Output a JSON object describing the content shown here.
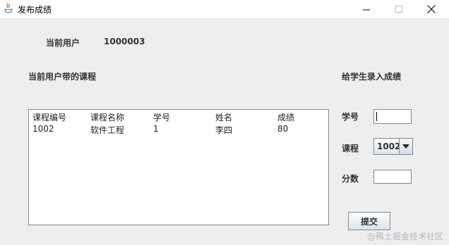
{
  "window": {
    "title": "发布成绩",
    "controls": {
      "minimize": "—",
      "maximize": "☐",
      "close": "✕"
    }
  },
  "header": {
    "current_user_label": "当前用户",
    "current_user_value": "1000003"
  },
  "courses_section": {
    "title": "当前用户带的课程",
    "columns": [
      "课程编号",
      "课程名称",
      "学号",
      "姓名",
      "成绩"
    ],
    "rows": [
      [
        "1002",
        "软件工程",
        "1",
        "李四",
        "80"
      ]
    ]
  },
  "grade_form": {
    "title": "给学生录入成绩",
    "student_id_label": "学号",
    "student_id_value": "",
    "course_label": "课程",
    "course_selected": "1002",
    "score_label": "分数",
    "score_value": "",
    "submit_label": "提交"
  },
  "watermark": "@稀土掘金技术社区"
}
